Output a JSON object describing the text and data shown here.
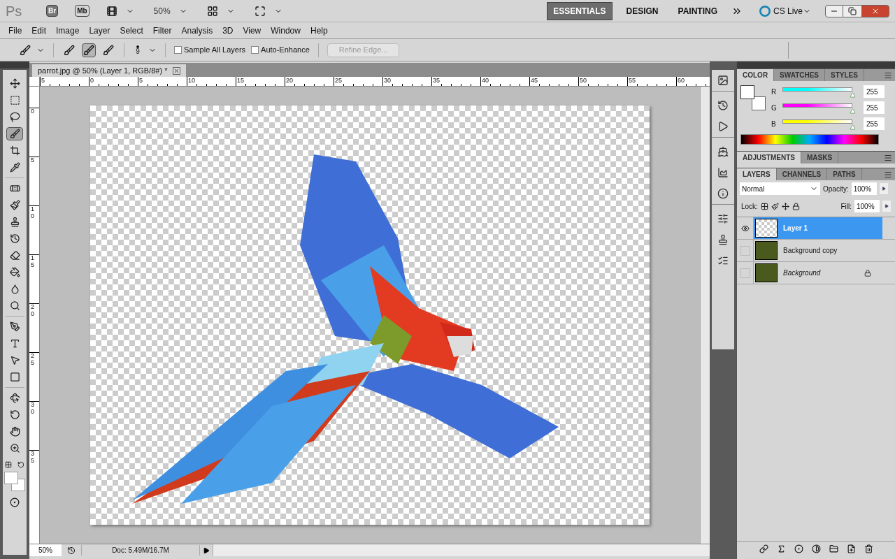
{
  "app_bar": {
    "logo": "Ps",
    "bridge": "Br",
    "mini_bridge": "Mb",
    "zoom": "50%",
    "workspaces": [
      {
        "label": "ESSENTIALS",
        "selected": true
      },
      {
        "label": "DESIGN",
        "selected": false
      },
      {
        "label": "PAINTING",
        "selected": false
      }
    ],
    "cs_live": "CS Live"
  },
  "menu": [
    "File",
    "Edit",
    "Image",
    "Layer",
    "Select",
    "Filter",
    "Analysis",
    "3D",
    "View",
    "Window",
    "Help"
  ],
  "options_bar": {
    "modes": [
      {
        "selected": false
      },
      {
        "selected": true
      },
      {
        "selected": false
      }
    ],
    "brush_size": "9",
    "checkboxes": [
      {
        "label": "Sample All Layers",
        "checked": false
      },
      {
        "label": "Auto-Enhance",
        "checked": false
      }
    ],
    "refine_edge": {
      "label": "Refine Edge...",
      "disabled": true
    }
  },
  "tools": [
    {
      "selected": false
    },
    {
      "selected": false
    },
    {
      "selected": false
    },
    {
      "selected": true
    },
    {
      "selected": false
    },
    {
      "selected": false
    },
    {
      "selected": false
    },
    {
      "selected": false
    },
    {
      "selected": false
    },
    {
      "selected": false
    },
    {
      "selected": false
    },
    {
      "selected": false
    },
    {
      "selected": false
    },
    {
      "selected": false
    },
    {
      "selected": false
    },
    {
      "selected": false
    },
    {
      "selected": false
    },
    {
      "selected": false
    },
    {
      "selected": false
    },
    {
      "selected": false
    },
    {
      "selected": false
    },
    {
      "selected": false
    }
  ],
  "document": {
    "tab": "parrot.jpg @ 50% (Layer 1, RGB/8#) *",
    "ruler_h": [
      "5",
      "0",
      "5",
      "10",
      "15",
      "20",
      "25",
      "30",
      "35",
      "40",
      "45",
      "50",
      "55",
      "60"
    ],
    "ruler_v": [
      "0",
      "5",
      "10",
      "15",
      "20",
      "25",
      "30",
      "35"
    ],
    "status": {
      "zoom": "50%",
      "doc": "Doc: 5.49M/16.7M"
    }
  },
  "color_panel": {
    "tabs": [
      {
        "label": "COLOR",
        "selected": true
      },
      {
        "label": "SWATCHES",
        "selected": false
      },
      {
        "label": "STYLES",
        "selected": false
      }
    ],
    "channels": [
      {
        "name": "R",
        "value": "255",
        "level": 1,
        "color": "#00ffff"
      },
      {
        "name": "G",
        "value": "255",
        "level": 1,
        "color": "#ff00ff"
      },
      {
        "name": "B",
        "value": "255",
        "level": 1,
        "color": "#ffff00"
      }
    ]
  },
  "adjustments_panel": {
    "tabs": [
      {
        "label": "ADJUSTMENTS",
        "selected": true
      },
      {
        "label": "MASKS",
        "selected": false
      }
    ]
  },
  "layers_panel": {
    "tabs": [
      {
        "label": "LAYERS",
        "selected": true
      },
      {
        "label": "CHANNELS",
        "selected": false
      },
      {
        "label": "PATHS",
        "selected": false
      }
    ],
    "blend_mode": "Normal",
    "opacity_label": "Opacity:",
    "opacity": "100%",
    "lock_label": "Lock:",
    "fill_label": "Fill:",
    "fill": "100%",
    "layers": [
      {
        "name": "Layer 1",
        "visible": true,
        "selected": true,
        "kind": "layer",
        "locked": false,
        "transparent": true
      },
      {
        "name": "Background copy",
        "visible": false,
        "selected": false,
        "kind": "layer",
        "locked": false,
        "transparent": false
      },
      {
        "name": "Background",
        "visible": false,
        "selected": false,
        "kind": "background",
        "locked": true,
        "transparent": false
      }
    ]
  }
}
